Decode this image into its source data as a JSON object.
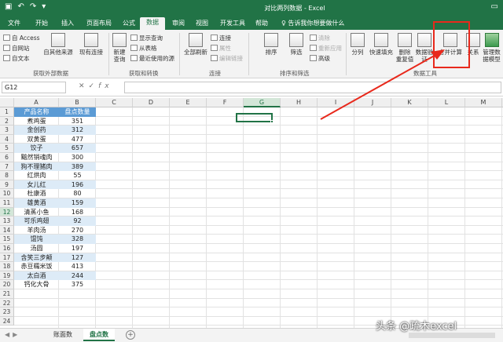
{
  "window": {
    "title": "对比两列数据 - Excel",
    "qat": [
      "save-icon",
      "undo-icon",
      "redo-icon",
      "customize-icon"
    ]
  },
  "tabs": [
    {
      "label": "文件"
    },
    {
      "label": "开始"
    },
    {
      "label": "插入"
    },
    {
      "label": "页面布局"
    },
    {
      "label": "公式"
    },
    {
      "label": "数据",
      "active": true
    },
    {
      "label": "审阅"
    },
    {
      "label": "视图"
    },
    {
      "label": "开发工具"
    },
    {
      "label": "帮助"
    }
  ],
  "tell_me": "告诉我你想要做什么",
  "ribbon": {
    "external": {
      "items": [
        "自 Access",
        "自网站",
        "自文本"
      ],
      "btn_other": "自其他来源",
      "btn_existing": "现有连接",
      "label": "获取外部数据"
    },
    "transform": {
      "btn_new": "新建\n查询",
      "items": [
        "显示查询",
        "从表格",
        "最近使用的源"
      ],
      "label": "获取和转换"
    },
    "connections": {
      "btn_refresh": "全部刷新",
      "items": [
        "连接",
        "属性",
        "编辑链接"
      ],
      "label": "连接"
    },
    "sort": {
      "btn_sort": "排序",
      "btn_filter": "筛选",
      "items": [
        "清除",
        "重新应用",
        "高级"
      ],
      "label": "排序和筛选"
    },
    "tools": {
      "btn_split": "分列",
      "btn_flash": "快速填充",
      "btn_remove": "删除\n重复值",
      "btn_validate": "数据验\n证",
      "btn_consolidate": "合并计算",
      "btn_relations": "关系",
      "btn_model": "管理数\n据模型",
      "label": "数据工具"
    }
  },
  "formula_bar": {
    "name_box": "G12",
    "fx": "fx",
    "value": ""
  },
  "grid": {
    "columns": [
      "A",
      "B",
      "C",
      "D",
      "E",
      "F",
      "G",
      "H",
      "I",
      "J",
      "K",
      "L",
      "M",
      "N"
    ],
    "selected_col": "G",
    "selected_row": 12,
    "row_count": 24,
    "header": [
      "产品名称",
      "盘点数量"
    ],
    "rows": [
      [
        "煮鸡蛋",
        "351"
      ],
      [
        "金创药",
        "312"
      ],
      [
        "双黄蛋",
        "477"
      ],
      [
        "饺子",
        "657"
      ],
      [
        "黯然销魂肉",
        "300"
      ],
      [
        "狗不理猪肉",
        "389"
      ],
      [
        "红烘肉",
        "55"
      ],
      [
        "女儿红",
        "196"
      ],
      [
        "杜康酒",
        "80"
      ],
      [
        "雄黄酒",
        "159"
      ],
      [
        "清蒸小鱼",
        "168"
      ],
      [
        "可乐鸡翅",
        "92"
      ],
      [
        "羊肉汤",
        "270"
      ],
      [
        "馄饨",
        "328"
      ],
      [
        "汤圆",
        "197"
      ],
      [
        "含笑三步颠",
        "127"
      ],
      [
        "赤豆糯米饭",
        "413"
      ],
      [
        "太白酒",
        "244"
      ],
      [
        "钙化大骨",
        "375"
      ]
    ]
  },
  "sheets": [
    {
      "label": "账面数"
    },
    {
      "label": "盘点数",
      "active": true
    }
  ],
  "watermark": "头条 @疏木excel",
  "colors": {
    "accent": "#217346",
    "header_fill": "#5b9bd5",
    "band": "#ddebf7",
    "annotation": "#e8291c"
  }
}
